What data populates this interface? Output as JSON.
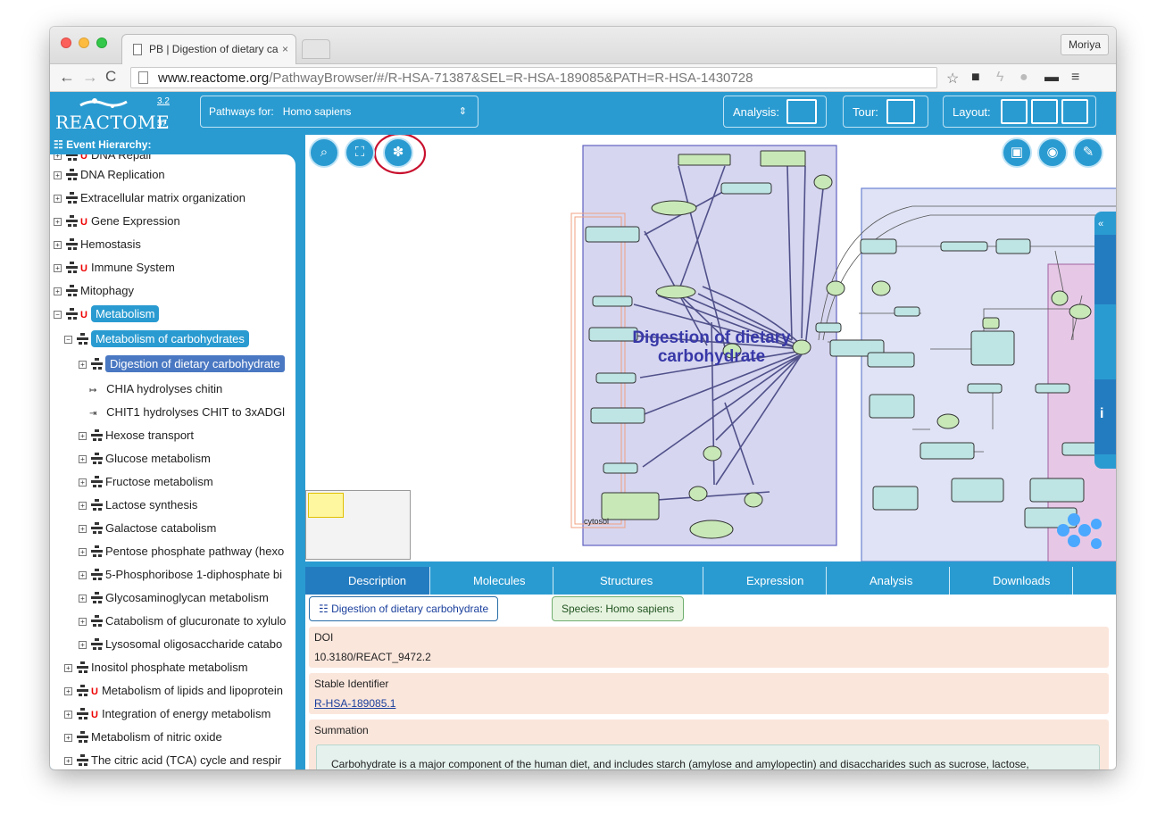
{
  "browser": {
    "tab_title": "PB | Digestion of dietary ca",
    "profile": "Moriya",
    "url_host": "www.reactome.org",
    "url_path": "/PathwayBrowser/#/R-HSA-71387&SEL=R-HSA-189085&PATH=R-HSA-1430728"
  },
  "header": {
    "logo": "REACTOME",
    "version_a": "3.2",
    "version_b": "57",
    "species_label": "Pathways for:",
    "species_value": "Homo sapiens",
    "analysis_label": "Analysis:",
    "tour_label": "Tour:",
    "layout_label": "Layout:"
  },
  "hierarchy": {
    "title": "Event Hierarchy:",
    "items": [
      {
        "label": "DNA Repair",
        "u": true
      },
      {
        "label": "DNA Replication",
        "u": false
      },
      {
        "label": "Extracellular matrix organization",
        "u": false
      },
      {
        "label": "Gene Expression",
        "u": true
      },
      {
        "label": "Hemostasis",
        "u": false
      },
      {
        "label": "Immune System",
        "u": true
      },
      {
        "label": "Mitophagy",
        "u": false
      },
      {
        "label": "Metabolism",
        "u": true
      },
      {
        "label": "Metabolism of carbohydrates",
        "u": false
      },
      {
        "label": "Digestion of dietary carbohydrate",
        "u": false
      },
      {
        "label": "CHIA hydrolyses chitin",
        "u": false
      },
      {
        "label": "CHIT1 hydrolyses CHIT to 3xADGl",
        "u": false
      },
      {
        "label": "Hexose transport",
        "u": false
      },
      {
        "label": "Glucose metabolism",
        "u": false
      },
      {
        "label": "Fructose metabolism",
        "u": false
      },
      {
        "label": "Lactose synthesis",
        "u": false
      },
      {
        "label": "Galactose catabolism",
        "u": false
      },
      {
        "label": "Pentose phosphate pathway (hexo",
        "u": false
      },
      {
        "label": "5-Phosphoribose 1-diphosphate bi",
        "u": false
      },
      {
        "label": "Glycosaminoglycan metabolism",
        "u": false
      },
      {
        "label": "Catabolism of glucuronate to xylulo",
        "u": false
      },
      {
        "label": "Lysosomal oligosaccharide catabo",
        "u": false
      },
      {
        "label": "Inositol phosphate metabolism",
        "u": false
      },
      {
        "label": "Metabolism of lipids and lipoprotein",
        "u": true
      },
      {
        "label": "Integration of energy metabolism",
        "u": true
      },
      {
        "label": "Metabolism of nitric oxide",
        "u": false
      },
      {
        "label": "The citric acid (TCA) cycle and respir",
        "u": false
      }
    ]
  },
  "diagram": {
    "title": "Digestion of dietary carbohydrate",
    "title_line1": "Digestion of dietary",
    "title_line2": "carbohydrate",
    "compartment": "cytosol"
  },
  "details": {
    "tabs": [
      "Description",
      "Molecules",
      "Structures",
      "Expression",
      "Analysis",
      "Downloads"
    ],
    "pathway_chip": "Digestion of dietary carbohydrate",
    "species_chip": "Species: Homo sapiens",
    "doi_label": "DOI",
    "doi_value": "10.3180/REACT_9472.2",
    "stable_id_label": "Stable Identifier",
    "stable_id_value": "R-HSA-189085.1",
    "summation_label": "Summation",
    "summation_text": "Carbohydrate is a major component of the human diet, and includes starch (amylose and amylopectin) and disaccharides such as sucrose, lactose,"
  },
  "colors": {
    "reactome_blue": "#2a9bd1",
    "highlight_blue": "#4a78c2",
    "annotation_red": "#c8102e"
  }
}
